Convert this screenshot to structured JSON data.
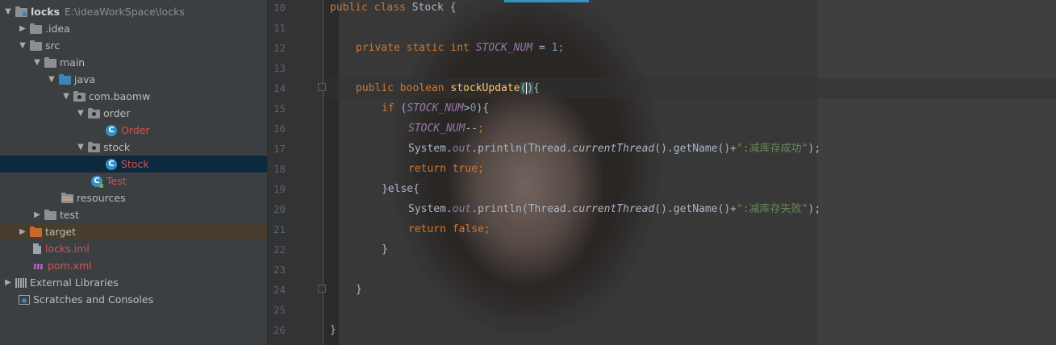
{
  "project_tree": [
    {
      "name": "locks",
      "path": "E:\\ideaWorkSpace\\locks",
      "arrow": "▼",
      "icon": "module-folder",
      "indent": 0
    },
    {
      "name": ".idea",
      "arrow": "▶",
      "icon": "folder",
      "indent": 1
    },
    {
      "name": "src",
      "arrow": "▼",
      "icon": "folder",
      "indent": 1
    },
    {
      "name": "main",
      "arrow": "▼",
      "icon": "folder",
      "indent": 2
    },
    {
      "name": "java",
      "arrow": "▼",
      "icon": "source-folder",
      "indent": 3
    },
    {
      "name": "com.baomw",
      "arrow": "▼",
      "icon": "package",
      "indent": 4
    },
    {
      "name": "order",
      "arrow": "▼",
      "icon": "package",
      "indent": 5
    },
    {
      "name": "Order",
      "arrow": "",
      "icon": "class",
      "indent": 6
    },
    {
      "name": "stock",
      "arrow": "▼",
      "icon": "package",
      "indent": 5
    },
    {
      "name": "Stock",
      "arrow": "",
      "icon": "class",
      "indent": 6
    },
    {
      "name": "Test",
      "arrow": "",
      "icon": "test-class",
      "indent": 5
    },
    {
      "name": "resources",
      "arrow": "",
      "icon": "resources-folder",
      "indent": 3
    },
    {
      "name": "test",
      "arrow": "▶",
      "icon": "folder",
      "indent": 2
    },
    {
      "name": "target",
      "arrow": "▶",
      "icon": "excluded-folder",
      "indent": 1
    },
    {
      "name": "locks.iml",
      "arrow": "",
      "icon": "iml-file",
      "indent": 1
    },
    {
      "name": "pom.xml",
      "arrow": "",
      "icon": "maven-file",
      "indent": 1
    },
    {
      "name": "External Libraries",
      "arrow": "▶",
      "icon": "library",
      "indent": 0
    },
    {
      "name": "Scratches and Consoles",
      "arrow": "",
      "icon": "scratches",
      "indent": 0
    }
  ],
  "line_numbers": [
    "10",
    "11",
    "12",
    "13",
    "14",
    "15",
    "16",
    "17",
    "18",
    "19",
    "20",
    "21",
    "22",
    "23",
    "24",
    "25",
    "26"
  ],
  "code": {
    "l10": {
      "kw1": "public class ",
      "name": "Stock {"
    },
    "l12": {
      "kw": "private static int ",
      "field": "STOCK_NUM",
      "op": " = ",
      "num": "1",
      "semi": ";"
    },
    "l14": {
      "kw": "public boolean ",
      "method": "stockUpdate",
      "paren_open": "(",
      "paren_close": ")",
      "brace": "{"
    },
    "l15": {
      "kw": "if ",
      "p1": "(",
      "field": "STOCK_NUM",
      "op": ">",
      "num": "0",
      "p2": "){"
    },
    "l16": {
      "field": "STOCK_NUM",
      "op": "--",
      "semi": ";"
    },
    "l17": {
      "a": "System.",
      "out": "out",
      "b": ".println(Thread.",
      "ct": "currentThread",
      "c": "().getName()+",
      "str": "\":减库存成功\"",
      "d": ");"
    },
    "l18": {
      "kw": "return true",
      "semi": ";"
    },
    "l19": {
      "text": "}else{"
    },
    "l20": {
      "a": "System.",
      "out": "out",
      "b": ".println(Thread.",
      "ct": "currentThread",
      "c": "().getName()+",
      "str": "\":减库存失败\"",
      "d": ");"
    },
    "l21": {
      "kw": "return false",
      "semi": ";"
    },
    "l22": {
      "text": "}"
    },
    "l24": {
      "text": "}"
    },
    "l26": {
      "text": "}"
    }
  }
}
